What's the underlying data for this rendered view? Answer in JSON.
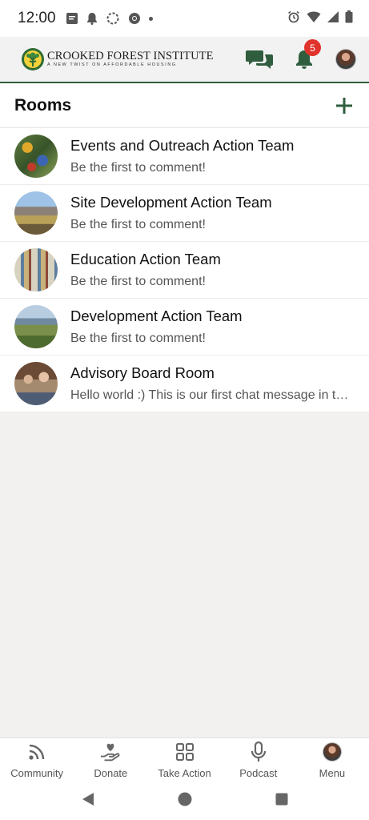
{
  "status_bar": {
    "time": "12:00"
  },
  "header": {
    "logo_title": "CROOKED FOREST INSTITUTE",
    "logo_subtitle": "A NEW TWIST ON AFFORDABLE HOUSING",
    "notification_count": "5",
    "brand_color": "#2f5d3d"
  },
  "rooms": {
    "title": "Rooms",
    "items": [
      {
        "name": "Events and Outreach Action Team",
        "message": "Be the first to comment!"
      },
      {
        "name": "Site Development Action Team",
        "message": "Be the first to comment!"
      },
      {
        "name": "Education Action Team",
        "message": "Be the first to comment!"
      },
      {
        "name": "Development Action Team",
        "message": "Be the first to comment!"
      },
      {
        "name": "Advisory Board Room",
        "message": "Hello world :) This is our first chat message in the Advisory Board Room"
      }
    ]
  },
  "bottom_nav": {
    "items": [
      {
        "label": "Community",
        "icon": "rss-icon"
      },
      {
        "label": "Donate",
        "icon": "heart-hand-icon"
      },
      {
        "label": "Take Action",
        "icon": "grid-icon"
      },
      {
        "label": "Podcast",
        "icon": "microphone-icon"
      },
      {
        "label": "Menu",
        "icon": "avatar"
      }
    ]
  }
}
